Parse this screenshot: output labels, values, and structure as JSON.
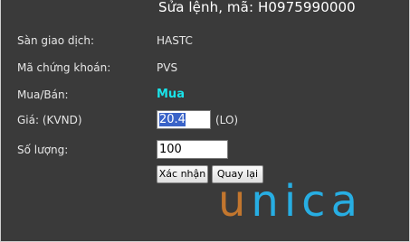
{
  "title": "Sửa lệnh, mã: H0975990000",
  "fields": {
    "exchange_label": "Sàn giao dịch:",
    "exchange_value": "HASTC",
    "symbol_label": "Mã chứng khoán:",
    "symbol_value": "PVS",
    "side_label": "Mua/Bán:",
    "side_value": "Mua",
    "price_label": "Giá:  (KVND)",
    "price_value": "20.4",
    "price_unit": "(LO)",
    "quantity_label": "Số lượng:",
    "quantity_value": "100"
  },
  "buttons": {
    "confirm_label": "Xác nhận",
    "back_label": "Quay lại"
  },
  "watermark": {
    "first_letter": "u",
    "rest": "nica"
  },
  "colors": {
    "background": "#3a3a3a",
    "side_value": "#19e3e9",
    "logo_u": "#c2762e",
    "logo_rest": "#27aee3",
    "selection": "#3a63c8"
  }
}
